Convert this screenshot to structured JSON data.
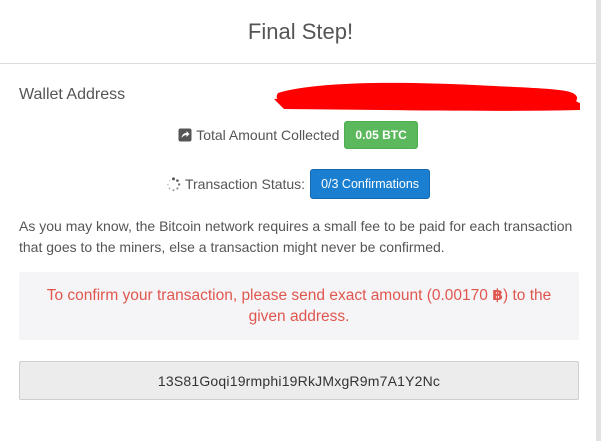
{
  "header": {
    "title": "Final Step!"
  },
  "wallet": {
    "label": "Wallet Address",
    "value_redacted": true
  },
  "amount": {
    "icon": "external-share-icon",
    "label": "Total Amount Collected",
    "badge": "0.05 BTC",
    "badge_color": "#5cb85c"
  },
  "status": {
    "icon": "spinner-icon",
    "label": "Transaction Status:",
    "badge": "0/3 Confirmations",
    "badge_color": "#1a7fd1"
  },
  "info": {
    "text": "As you may know, the Bitcoin network requires a small fee to be paid for each transaction that goes to the miners, else a transaction might never be confirmed."
  },
  "alert": {
    "before": "To confirm your transaction, please send exact amount (0.00170 ",
    "currency_symbol": "฿",
    "after": ") to the given address.",
    "color": "#e0564f"
  },
  "address": {
    "value": "13S81Goqi19rmphi19RkJMxgR9m7A1Y2Nc"
  },
  "colors": {
    "redaction": "#ff0000"
  }
}
